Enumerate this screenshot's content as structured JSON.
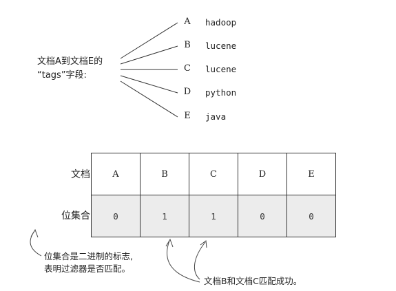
{
  "field_label": {
    "line1": "文档A到文档E的",
    "line2": "“tags”字段:"
  },
  "documents": [
    {
      "letter": "A",
      "tag": "hadoop"
    },
    {
      "letter": "B",
      "tag": "lucene"
    },
    {
      "letter": "C",
      "tag": "lucene"
    },
    {
      "letter": "D",
      "tag": "python"
    },
    {
      "letter": "E",
      "tag": "java"
    }
  ],
  "table": {
    "row1_label": "文档",
    "row2_label": "位集合",
    "letters": [
      "A",
      "B",
      "C",
      "D",
      "E"
    ],
    "bits": [
      "0",
      "1",
      "1",
      "0",
      "0"
    ]
  },
  "notes": {
    "bitset_line1": "位集合是二进制的标志,",
    "bitset_line2": "表明过滤器是否匹配。",
    "match": "文档B和文档C匹配成功。"
  },
  "colors": {
    "line": "#333333",
    "bit_cell_bg": "#ececec"
  }
}
